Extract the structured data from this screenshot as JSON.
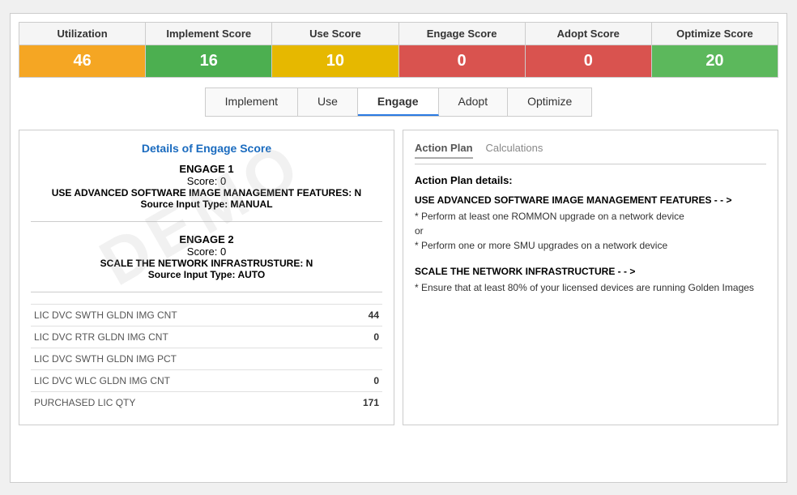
{
  "scores": [
    {
      "label": "Utilization",
      "value": "46",
      "labelBg": "header-neutral",
      "valueBg": "bg-orange"
    },
    {
      "label": "Implement Score",
      "value": "16",
      "valueBg": "bg-green"
    },
    {
      "label": "Use Score",
      "value": "10",
      "valueBg": "bg-yellow"
    },
    {
      "label": "Engage Score",
      "value": "0",
      "valueBg": "bg-red"
    },
    {
      "label": "Adopt Score",
      "value": "0",
      "valueBg": "bg-red"
    },
    {
      "label": "Optimize Score",
      "value": "20",
      "valueBg": "bg-green2"
    }
  ],
  "tabs": [
    "Implement",
    "Use",
    "Engage",
    "Adopt",
    "Optimize"
  ],
  "activeTab": "Engage",
  "leftPanel": {
    "title": "Details of Engage Score",
    "sections": [
      {
        "title": "ENGAGE 1",
        "score": "Score: 0",
        "desc": "USE ADVANCED SOFTWARE IMAGE MANAGEMENT FEATURES: N",
        "source": "Source Input Type: MANUAL"
      },
      {
        "title": "ENGAGE 2",
        "score": "Score: 0",
        "desc": "SCALE THE NETWORK INFRASTRUSTURE: N",
        "source": "Source Input Type: AUTO"
      }
    ],
    "dataRows": [
      {
        "label": "LIC DVC SWTH GLDN IMG CNT",
        "value": "44"
      },
      {
        "label": "LIC DVC RTR GLDN IMG CNT",
        "value": "0"
      },
      {
        "label": "LIC DVC SWTH GLDN IMG PCT",
        "value": ""
      },
      {
        "label": "LIC DVC WLC GLDN IMG CNT",
        "value": "0"
      },
      {
        "label": "PURCHASED LIC QTY",
        "value": "171"
      }
    ]
  },
  "rightPanel": {
    "tabs": [
      "Action Plan",
      "Calculations"
    ],
    "activeTab": "Action Plan",
    "actionPlanTitle": "Action Plan details:",
    "actionItems": [
      {
        "title": "USE ADVANCED SOFTWARE IMAGE MANAGEMENT FEATURES - - >",
        "body": "* Perform at least one ROMMON upgrade on a network device\nor\n* Perform one or more SMU upgrades on a network device"
      },
      {
        "title": "SCALE THE NETWORK INFRASTRUCTURE - - >",
        "body": "* Ensure that at least 80% of your licensed devices are running Golden Images"
      }
    ]
  },
  "watermark": "DEMO"
}
